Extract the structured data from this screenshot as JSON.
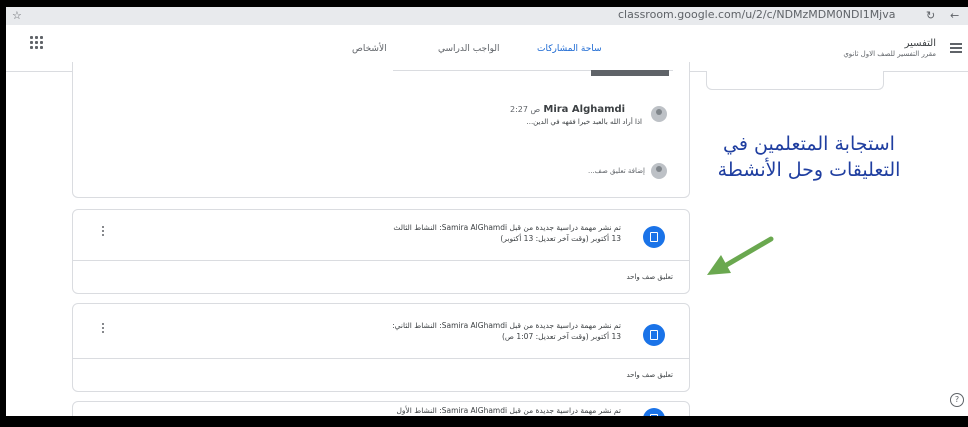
{
  "browser": {
    "url": "classroom.google.com/u/2/c/NDMzMDM0NDI1Mjva"
  },
  "header": {
    "course_title": "التفسير",
    "course_subtitle": "مقرر التفسير للصف الاول ثانوي",
    "tabs": [
      {
        "label": "ساحة المشاركات",
        "active": true
      },
      {
        "label": "الواجب الدراسي",
        "active": false
      },
      {
        "label": "الأشخاص",
        "active": false
      }
    ]
  },
  "comment_card": {
    "comment": {
      "author": "Mira Alghamdi",
      "time": "2:27 ص",
      "text": "اذا أراد الله بالعبد خيرا فقهه في الدين..."
    },
    "add_comment_placeholder": "إضافة تعليق صف..."
  },
  "posts": [
    {
      "title": "تم نشر مهمة دراسية جديدة من قبل Samira AlGhamdi: النشاط الثالث",
      "date": "13 أكتوبر (وقت آخر تعديل: 13 أكتوبر)",
      "comment_link": "تعليق صف واحد"
    },
    {
      "title": "تم نشر مهمة دراسية جديدة من قبل Samira AlGhamdi: النشاط الثاني:",
      "date": "13 أكتوبر (وقت آخر تعديل: 1:07 ص)",
      "comment_link": "تعليق صف واحد"
    },
    {
      "title": "تم نشر مهمة دراسية جديدة من قبل Samira AlGhamdi: النشاط الأول"
    }
  ],
  "annotation": {
    "text": "استجابة المتعلمين في التعليقات وحل الأنشطة",
    "color": "#1f3ea0",
    "arrow_color": "#6aa84f"
  },
  "help_glyph": "?"
}
